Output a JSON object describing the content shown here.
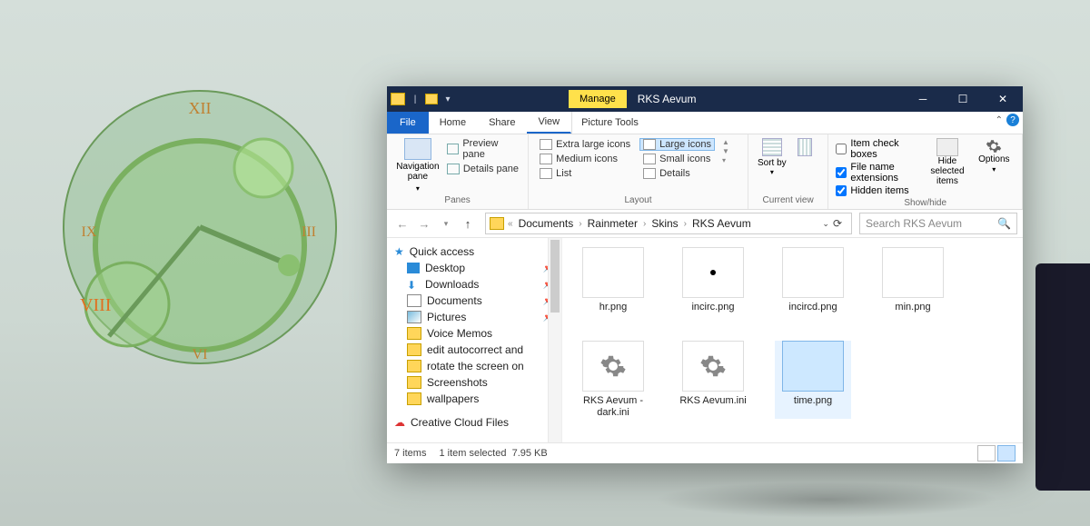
{
  "window": {
    "title": "RKS Aevum",
    "manage_tab": "Manage",
    "file_tab": "File",
    "tabs": [
      "Home",
      "Share",
      "View"
    ],
    "picture_tools": "Picture Tools"
  },
  "ribbon": {
    "panes": {
      "label": "Panes",
      "navigation_pane": "Navigation pane",
      "preview_pane": "Preview pane",
      "details_pane": "Details pane"
    },
    "layout": {
      "label": "Layout",
      "extra_large": "Extra large icons",
      "large": "Large icons",
      "medium": "Medium icons",
      "small": "Small icons",
      "list": "List",
      "details": "Details"
    },
    "current_view": {
      "label": "Current view",
      "sort_by": "Sort by"
    },
    "show_hide": {
      "label": "Show/hide",
      "item_check": "Item check boxes",
      "file_ext": "File name extensions",
      "hidden": "Hidden items",
      "hide_selected": "Hide selected items",
      "options": "Options"
    }
  },
  "breadcrumbs": [
    "Documents",
    "Rainmeter",
    "Skins",
    "RKS Aevum"
  ],
  "search_placeholder": "Search RKS Aevum",
  "nav": {
    "quick_access": "Quick access",
    "items": [
      {
        "label": "Desktop",
        "pinned": true
      },
      {
        "label": "Downloads",
        "pinned": true
      },
      {
        "label": "Documents",
        "pinned": true
      },
      {
        "label": "Pictures",
        "pinned": true
      },
      {
        "label": "Voice Memos",
        "pinned": false
      },
      {
        "label": "edit autocorrect and",
        "pinned": false
      },
      {
        "label": "rotate the screen on",
        "pinned": false
      },
      {
        "label": "Screenshots",
        "pinned": false
      },
      {
        "label": "wallpapers",
        "pinned": false
      }
    ],
    "cloud": "Creative Cloud Files"
  },
  "files": [
    {
      "name": "hr.png",
      "type": "img"
    },
    {
      "name": "incirc.png",
      "type": "img-dot"
    },
    {
      "name": "incircd.png",
      "type": "img"
    },
    {
      "name": "min.png",
      "type": "img"
    },
    {
      "name": "RKS Aevum - dark.ini",
      "type": "ini"
    },
    {
      "name": "RKS Aevum.ini",
      "type": "ini"
    },
    {
      "name": "time.png",
      "type": "img",
      "selected": true
    }
  ],
  "status": {
    "count": "7 items",
    "selection": "1 item selected",
    "size": "7.95 KB"
  }
}
